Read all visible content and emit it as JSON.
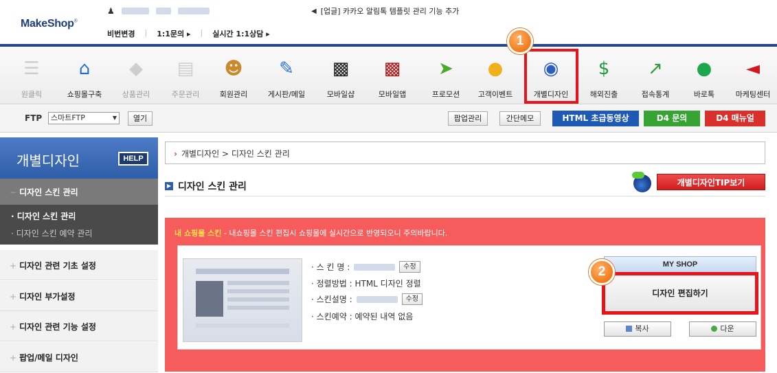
{
  "header": {
    "logo": "MakeShop",
    "logo_mark": "®",
    "notice": "[업글] 카카오 알림톡 템플릿 관리 기능 추가",
    "links": [
      "비번변경",
      "1:1문의",
      "실시간 1:1상담"
    ]
  },
  "toolbar": {
    "items": [
      {
        "label": "원클릭",
        "icon": "touch-icon"
      },
      {
        "label": "쇼핑몰구축",
        "icon": "home-icon"
      },
      {
        "label": "상품관리",
        "icon": "tag-icon"
      },
      {
        "label": "주문관리",
        "icon": "order-icon"
      },
      {
        "label": "회원관리",
        "icon": "member-icon"
      },
      {
        "label": "게시판/메일",
        "icon": "board-icon"
      },
      {
        "label": "모바일샵",
        "icon": "mobile-shop-icon"
      },
      {
        "label": "모바일앱",
        "icon": "mobile-app-icon"
      },
      {
        "label": "프로모션",
        "icon": "promotion-icon"
      },
      {
        "label": "고객이벤트",
        "icon": "event-icon"
      },
      {
        "label": "개별디자인",
        "icon": "design-icon"
      },
      {
        "label": "해외진출",
        "icon": "overseas-icon"
      },
      {
        "label": "접속통계",
        "icon": "stats-icon"
      },
      {
        "label": "바로톡",
        "icon": "chat-icon"
      },
      {
        "label": "마케팅센터",
        "icon": "marketing-icon"
      }
    ],
    "badge1": "1"
  },
  "ftpbar": {
    "label": "FTP",
    "select_value": "스마트FTP",
    "open_button": "열기",
    "popup_button": "팝업관리",
    "memo_button": "간단메모",
    "html_video_button": "HTML 초급동영상",
    "d4_inquiry_button": "D4 문의",
    "d4_manual_button": "D4 매뉴얼"
  },
  "sidebar": {
    "title": "개별디자인",
    "help": "HELP",
    "active_menu": "디자인 스킨 관리",
    "sub_items": [
      "· 디자인 스킨 관리",
      "· 디자인 스킨 예약 관리"
    ],
    "menus": [
      "디자인 관련 기초 설정",
      "디자인 부가설정",
      "디자인 관련 기능 설정",
      "팝업/메일 디자인"
    ]
  },
  "main": {
    "breadcrumb": "개별디자인 > 디자인 스킨 관리",
    "section_title": "디자인 스킨 관리",
    "tip_button": "개별디자인TIP보기",
    "notice_highlight": "내 쇼핑몰 스킨",
    "notice_text": " - 내쇼핑몰 스킨 편집시 쇼핑몰에 실시간으로 반영되오니 주의바랍니다.",
    "skin_name_label": "· 스 킨 명  :",
    "edit_label": "수정",
    "sort_label": "· 정렬방법 : HTML 디자인 정렬",
    "desc_label": "· 스킨설명 :",
    "reserve_label": "· 스킨예약 : 예약된 내역 없음",
    "myshop": "MY SHOP",
    "edit_design_button": "디자인 편집하기",
    "copy_button": "복사",
    "down_button": "다운",
    "badge2": "2"
  },
  "colors": {
    "accent": "#2f5ea9",
    "highlight": "#e8141b",
    "notice_bg": "#f65c5c"
  }
}
